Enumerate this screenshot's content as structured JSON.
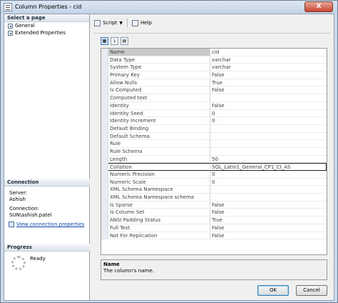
{
  "window": {
    "title": "Column Properties - cid",
    "close_label": "X"
  },
  "left": {
    "select_page_header": "Select a page",
    "pages": [
      "General",
      "Extended Properties"
    ],
    "connection_header": "Connection",
    "server_label": "Server:",
    "server_value": "Ashish",
    "connection_label": "Connection:",
    "connection_value": "SUN\\ashish.patel",
    "view_link": "View connection properties",
    "progress_header": "Progress",
    "progress_status": "Ready"
  },
  "toolbar": {
    "script_label": "Script",
    "help_label": "Help"
  },
  "properties": [
    {
      "name": "Name",
      "value": "cid"
    },
    {
      "name": "Data Type",
      "value": "varchar"
    },
    {
      "name": "System Type",
      "value": "varchar"
    },
    {
      "name": "Primary Key",
      "value": "False"
    },
    {
      "name": "Allow Nulls",
      "value": "True"
    },
    {
      "name": "Is Computed",
      "value": "False"
    },
    {
      "name": "Computed text",
      "value": ""
    },
    {
      "name": "Identity",
      "value": "False"
    },
    {
      "name": "Identity Seed",
      "value": "0"
    },
    {
      "name": "Identity Increment",
      "value": "0"
    },
    {
      "name": "Default Binding",
      "value": ""
    },
    {
      "name": "Default Schema",
      "value": ""
    },
    {
      "name": "Rule",
      "value": ""
    },
    {
      "name": "Rule Schema",
      "value": ""
    },
    {
      "name": "Length",
      "value": "50"
    },
    {
      "name": "Collation",
      "value": "SQL_Latin1_General_CP1_CI_AS"
    },
    {
      "name": "Numeric Precision",
      "value": "0"
    },
    {
      "name": "Numeric Scale",
      "value": "0"
    },
    {
      "name": "XML Schema Namespace",
      "value": ""
    },
    {
      "name": "XML Schema Namespace schema",
      "value": ""
    },
    {
      "name": "Is Sparse",
      "value": "False"
    },
    {
      "name": "Is Column Set",
      "value": "False"
    },
    {
      "name": "ANSI Padding Status",
      "value": "True"
    },
    {
      "name": "Full Text",
      "value": "False"
    },
    {
      "name": "Not For Replication",
      "value": "False"
    }
  ],
  "description": {
    "title": "Name",
    "text": "The column's name."
  },
  "buttons": {
    "ok": "OK",
    "cancel": "Cancel"
  }
}
